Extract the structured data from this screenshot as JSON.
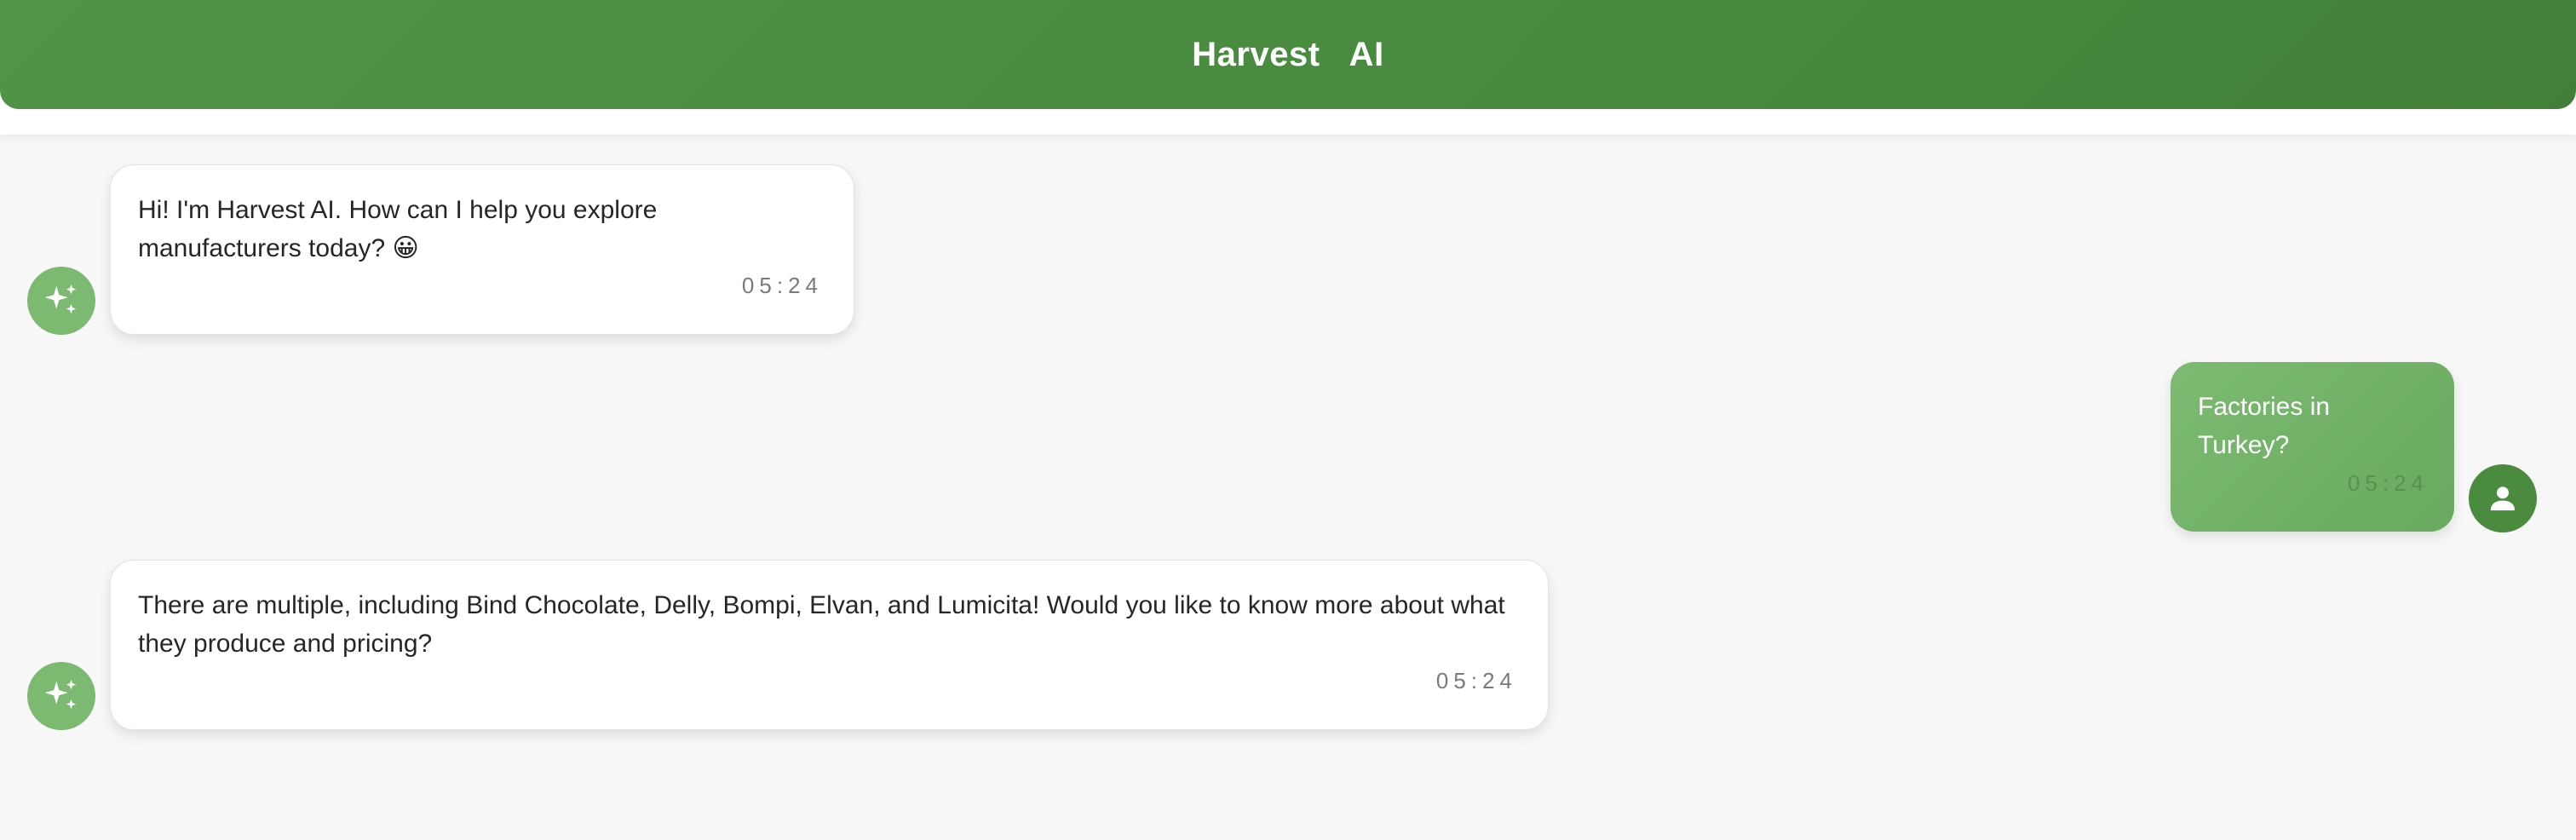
{
  "header": {
    "title": "Harvest AI"
  },
  "messages": [
    {
      "sender": "assistant",
      "avatar_icon": "sparkles-icon",
      "text": "Hi! I'm Harvest AI. How can I help you explore manufacturers today? 😀",
      "time": "05:24"
    },
    {
      "sender": "user",
      "avatar_icon": "user-icon",
      "text": "Factories in Turkey?",
      "time": "05:24"
    },
    {
      "sender": "assistant",
      "avatar_icon": "sparkles-icon",
      "text": "There are multiple, including Bind Chocolate, Delly, Bompi, Elvan, and Lumicita! Would you like to know more about what they produce and pricing?",
      "time": "05:24"
    }
  ],
  "colors": {
    "header_green": "#4a8b3f",
    "ai_avatar": "#7cba72",
    "user_bubble": "#72b267",
    "background": "#f7f7f7"
  }
}
